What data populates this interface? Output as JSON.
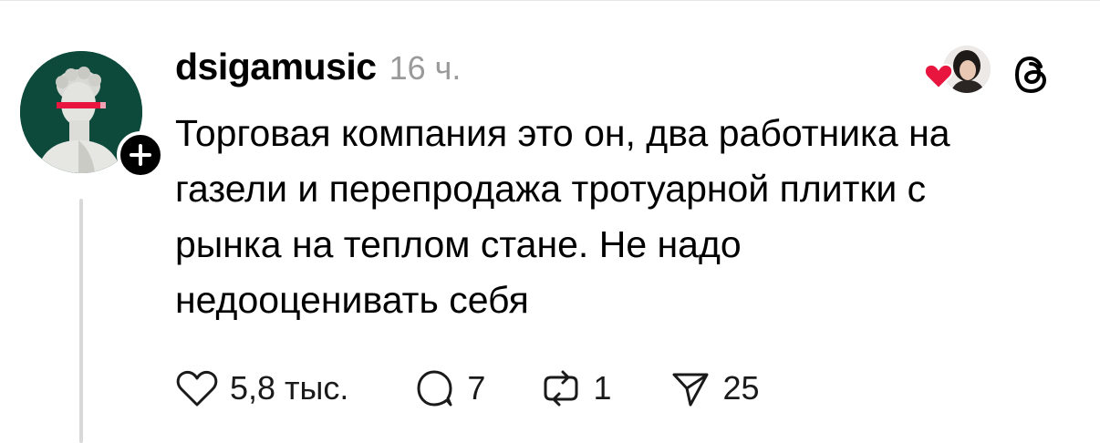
{
  "post": {
    "username": "dsigamusic",
    "timestamp": "16 ч.",
    "text": "Торговая компания это он, два работника на\nгазели и перепродажа тротуарной плитки с\nрынка на теплом стане. Не надо\nнедооценивать себя",
    "actions": {
      "like_count": "5,8 тыс.",
      "reply_count": "7",
      "repost_count": "1",
      "share_count": "25"
    }
  },
  "colors": {
    "avatar_bg": "#0d4a3c",
    "heart": "#e8163f",
    "muted_text": "#9a9a9a",
    "thread_line": "#d9d9d9"
  },
  "icons": {
    "follow": "plus-icon",
    "like": "heart-outline-icon",
    "reply": "speech-bubble-icon",
    "repost": "repost-icon",
    "share": "paper-plane-icon",
    "app": "threads-logo-icon",
    "liked_by_author": "heart-filled-icon"
  }
}
